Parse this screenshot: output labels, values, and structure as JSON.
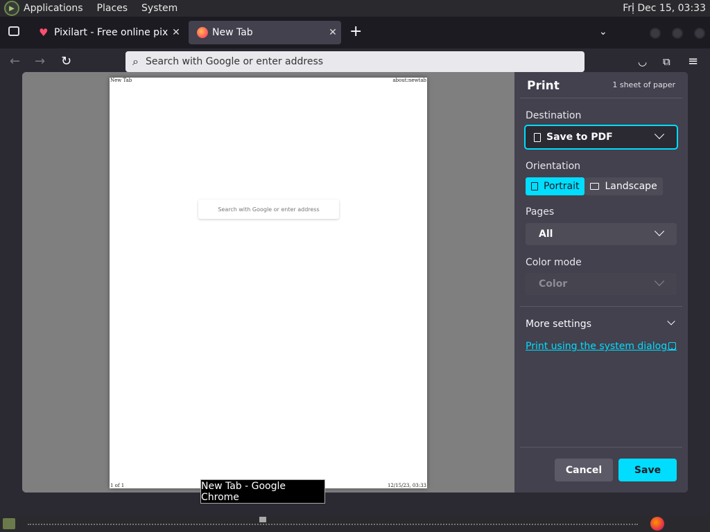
{
  "system_bar": {
    "menus": [
      "Applications",
      "Places",
      "System"
    ],
    "clock": "Fri Dec 15, 03:33"
  },
  "tabs": [
    {
      "title": "Pixilart - Free online pixel ar",
      "icon": "heart-icon",
      "active": false
    },
    {
      "title": "New Tab",
      "icon": "firefox-icon",
      "active": true
    }
  ],
  "toolbar": {
    "url_placeholder": "Search with Google or enter address"
  },
  "print_preview": {
    "header_left": "New Tab",
    "header_right": "about:newtab",
    "footer_left": "1 of 1",
    "footer_right": "12/15/23, 03:33",
    "search_placeholder": "Search with Google or enter address"
  },
  "print_panel": {
    "title": "Print",
    "sheet_count": "1 sheet of paper",
    "destination_label": "Destination",
    "destination_value": "Save to PDF",
    "orientation_label": "Orientation",
    "orientation_portrait": "Portrait",
    "orientation_landscape": "Landscape",
    "orientation_selected": "Portrait",
    "pages_label": "Pages",
    "pages_value": "All",
    "color_mode_label": "Color mode",
    "color_mode_value": "Color",
    "more_settings": "More settings",
    "system_dialog_link": "Print using the system dialog…",
    "cancel": "Cancel",
    "save": "Save",
    "accent_color": "#00ddff"
  },
  "tooltip": "New Tab - Google Chrome"
}
